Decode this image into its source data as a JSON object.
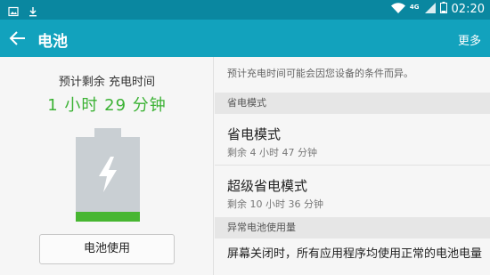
{
  "status_bar": {
    "network": "4G",
    "time": "02:20",
    "icons": [
      "image-icon",
      "download-icon",
      "wifi-icon",
      "signal-icon",
      "battery-icon"
    ]
  },
  "app_bar": {
    "title": "电池",
    "more_label": "更多"
  },
  "battery": {
    "estimate_label": "预计剩余 充电时间",
    "estimate_value": "1 小时 29 分钟",
    "level_fraction": 0.12,
    "usage_button": "电池使用",
    "colors": {
      "fill": "#47b631",
      "body": "#c9cfd3",
      "estimate": "#3bb234"
    }
  },
  "right_panel": {
    "note": "预计充电时间可能会因您设备的条件而异。",
    "power_saving_header": "省电模式",
    "modes": [
      {
        "title": "省电模式",
        "subtitle": "剩余 4 小时 47 分钟"
      },
      {
        "title": "超级省电模式",
        "subtitle": "剩余 10 小时 36 分钟"
      }
    ],
    "abnormal_header": "异常电池使用量",
    "abnormal_text": "屏幕关闭时，所有应用程序均使用正常的电池电量"
  },
  "colors": {
    "status_bar": "#0a87a0",
    "app_bar": "#12a2bd"
  }
}
